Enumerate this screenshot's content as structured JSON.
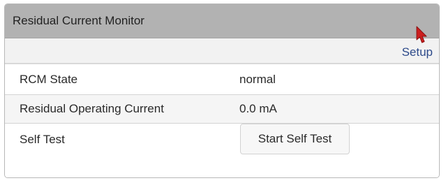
{
  "panel": {
    "title": "Residual Current Monitor"
  },
  "actions": {
    "setup_label": "Setup"
  },
  "rows": [
    {
      "label": "RCM State",
      "value": "normal"
    },
    {
      "label": "Residual Operating Current",
      "value": "0.0 mA"
    },
    {
      "label": "Self Test",
      "button_label": "Start Self Test"
    }
  ],
  "icons": {
    "cursor": "mouse-pointer-icon"
  },
  "colors": {
    "header_bg": "#b2b2b2",
    "link": "#2d4a8a",
    "cursor": "#cc1f1f"
  }
}
